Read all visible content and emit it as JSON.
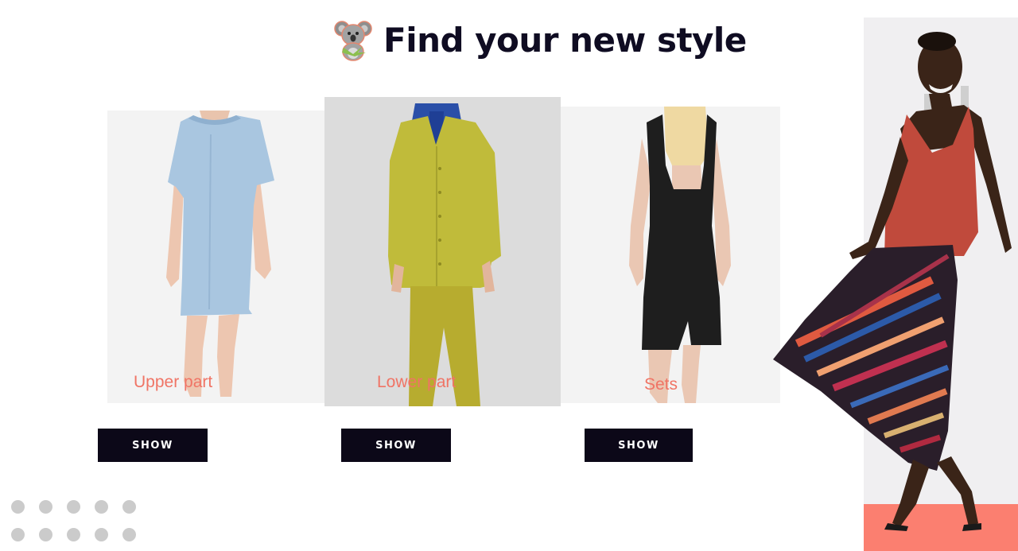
{
  "header": {
    "title": "Find your new style",
    "logo_icon": "koala-icon"
  },
  "categories": [
    {
      "label": "Upper part",
      "button_label": "SHOW",
      "image": "blue-dress-model-image"
    },
    {
      "label": "Lower part",
      "button_label": "SHOW",
      "image": "mustard-suit-model-image"
    },
    {
      "label": "Sets",
      "button_label": "SHOW",
      "image": "black-dress-model-image"
    }
  ],
  "hero": {
    "image": "model-sequin-skirt-image"
  },
  "colors": {
    "title": "#0f0c22",
    "label": "#f07465",
    "button_bg": "#0c0818",
    "accent_coral": "#fb7f70",
    "dots": "#cbcbcb"
  }
}
